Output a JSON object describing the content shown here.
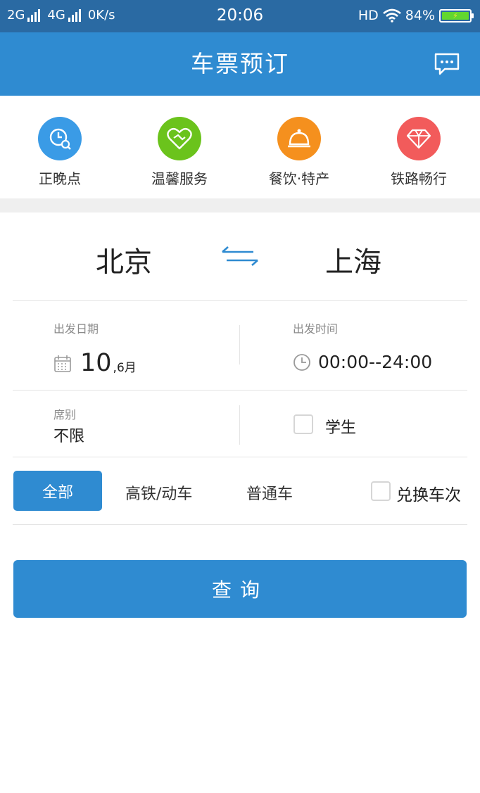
{
  "status_bar": {
    "net1": "2G",
    "net2": "4G",
    "speed": "0K/s",
    "time": "20:06",
    "hd": "HD",
    "battery": "84%"
  },
  "header": {
    "title": "车票预订",
    "message_icon": "message-icon"
  },
  "quick_links": [
    {
      "label": "正晚点",
      "icon": "clock-search-icon",
      "color": "#3a9be6"
    },
    {
      "label": "温馨服务",
      "icon": "heart-handshake-icon",
      "color": "#6bc31c"
    },
    {
      "label": "餐饮·特产",
      "icon": "food-cloche-icon",
      "color": "#f5901e"
    },
    {
      "label": "铁路畅行",
      "icon": "diamond-icon",
      "color": "#f25b5b"
    }
  ],
  "route": {
    "from": "北京",
    "to": "上海",
    "swap_icon": "swap-arrows-icon"
  },
  "depart_date": {
    "label": "出发日期",
    "day": "10",
    "month": ",6月"
  },
  "depart_time": {
    "label": "出发时间",
    "range": "00:00--24:00"
  },
  "seat": {
    "label": "席别",
    "value": "不限"
  },
  "student": {
    "label": "学生",
    "checked": false
  },
  "train_filters": {
    "all": "全部",
    "high_speed": "高铁/动车",
    "normal": "普通车",
    "exchange": "兑换车次",
    "exchange_checked": false
  },
  "query_button": "查询",
  "colors": {
    "accent": "#2f8bd1",
    "status_bar": "#2a6aa3"
  }
}
